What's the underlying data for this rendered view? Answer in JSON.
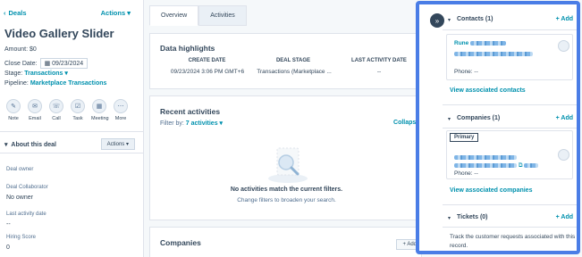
{
  "left": {
    "back_label": "Deals",
    "actions_label": "Actions",
    "title": "Video Gallery Slider",
    "amount_label": "Amount:",
    "amount_value": "$0",
    "close_date_label": "Close Date:",
    "close_date_value": "09/23/2024",
    "stage_label": "Stage:",
    "stage_value": "Transactions",
    "pipeline_label": "Pipeline:",
    "pipeline_value": "Marketplace Transactions",
    "quick_actions": [
      {
        "label": "Note",
        "icon": "pencil-icon"
      },
      {
        "label": "Email",
        "icon": "email-icon"
      },
      {
        "label": "Call",
        "icon": "phone-icon"
      },
      {
        "label": "Task",
        "icon": "task-icon"
      },
      {
        "label": "Meeting",
        "icon": "calendar-icon"
      },
      {
        "label": "More",
        "icon": "more-icon"
      }
    ],
    "about_title": "About this deal",
    "about_actions": "Actions",
    "fields": [
      {
        "label": "Deal owner",
        "value": ""
      },
      {
        "label": "Deal Collaborator",
        "value": "No owner"
      },
      {
        "label": "Last activity date",
        "value": "--"
      },
      {
        "label": "Hiring Score",
        "value": "0"
      }
    ]
  },
  "middle": {
    "tabs": [
      "Overview",
      "Activities"
    ],
    "highlights_title": "Data highlights",
    "highlights_headers": [
      "CREATE DATE",
      "DEAL STAGE",
      "LAST ACTIVITY DATE"
    ],
    "highlights_values": [
      "09/23/2024 3:06 PM GMT+6",
      "Transactions (Marketplace ...",
      "--"
    ],
    "recent_title": "Recent activities",
    "filter_label": "Filter by:",
    "filter_value": "7 activities",
    "collapse_all": "Collapse al",
    "empty_title": "No activities match the current filters.",
    "empty_sub": "Change filters to broaden your search.",
    "companies_title": "Companies",
    "companies_add": "+ Add"
  },
  "right": {
    "contacts_title": "Contacts (1)",
    "contacts_add": "+ Add",
    "contact_name": "Rune",
    "contact_phone": "Phone: --",
    "view_contacts": "View associated contacts",
    "companies_title": "Companies (1)",
    "companies_add": "+ Add",
    "primary_badge": "Primary",
    "company_phone": "Phone: --",
    "view_companies": "View associated companies",
    "tickets_title": "Tickets (0)",
    "tickets_add": "+ Add",
    "tickets_text": "Track the customer requests associated with this record.",
    "accent_color": "#4a7de6"
  }
}
